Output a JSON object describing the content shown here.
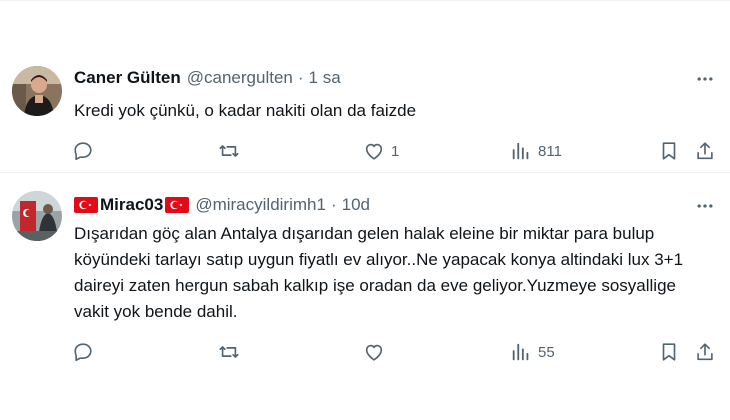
{
  "tweets": [
    {
      "name": "Caner Gülten",
      "handle": "@canergulten",
      "time": "1 sa",
      "text": "Kredi yok çünkü, o kadar nakiti olan da faizde",
      "reply_count": "",
      "retweet_count": "",
      "like_count": "1",
      "view_count": "811",
      "avatar_icon": "user-photo-avatar"
    },
    {
      "name": "Mirac03",
      "handle": "@miracyildirimh1",
      "time": "10d",
      "text": "Dışarıdan göç alan Antalya dışarıdan gelen halak eleine bir miktar para bulup köyündeki tarlayı satıp uygun fiyatlı ev alıyor..Ne yapacak konya altindaki lux 3+1 daireyi zaten hergun sabah kalkıp işe oradan da eve geliyor.Yuzmeye sosyallige vakit yok bende dahil.",
      "reply_count": "",
      "retweet_count": "",
      "like_count": "",
      "view_count": "55",
      "avatar_icon": "turkish-flag-avatar"
    }
  ],
  "separator": "·",
  "colors": {
    "text": "#0f1419",
    "secondary": "#536471",
    "border": "#eff3f4",
    "flag_red": "#e30a17"
  }
}
